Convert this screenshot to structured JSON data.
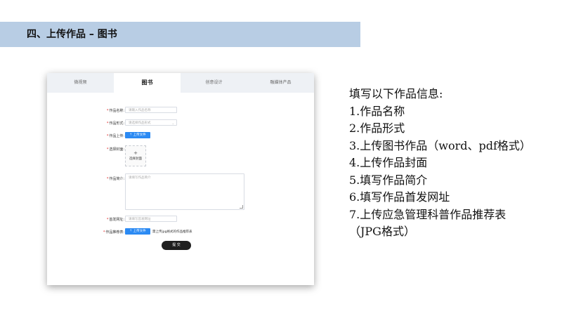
{
  "header": {
    "title": "四、上传作品 – 图书"
  },
  "tabs": [
    {
      "label": "微视频",
      "active": false
    },
    {
      "label": "图书",
      "active": true
    },
    {
      "label": "创意设计",
      "active": false
    },
    {
      "label": "融媒体产品",
      "active": false
    }
  ],
  "form": {
    "name": {
      "label": "作品名称:",
      "placeholder": "请输入作品名称"
    },
    "format": {
      "label": "作品形式:",
      "placeholder": "请选择作品形式"
    },
    "upload": {
      "label": "作品上传:",
      "button": "上传文件"
    },
    "cover": {
      "label": "选择封面:",
      "plus": "+",
      "text": "选择封面"
    },
    "intro": {
      "label": "作品简介:",
      "placeholder": "请填写作品简介"
    },
    "url": {
      "label": "首发网址:",
      "placeholder": "请填写首发网址"
    },
    "recommend": {
      "label": "作品推荐表:",
      "button": "上传文件",
      "hint": "需上传jpg格式的作品推荐表"
    },
    "submit": "提 交",
    "required_mark": "*",
    "upload_icon": "upload-icon",
    "accent_color": "#2b8af3"
  },
  "info": {
    "lines": [
      "填写以下作品信息:",
      "1.作品名称",
      "2.作品形式",
      "3.上传图书作品（word、pdf格式）",
      "4.上传作品封面",
      "5.填写作品简介",
      "6.填写作品首发网址",
      "7.上传应急管理科普作品推荐表",
      "（JPG格式）"
    ]
  }
}
